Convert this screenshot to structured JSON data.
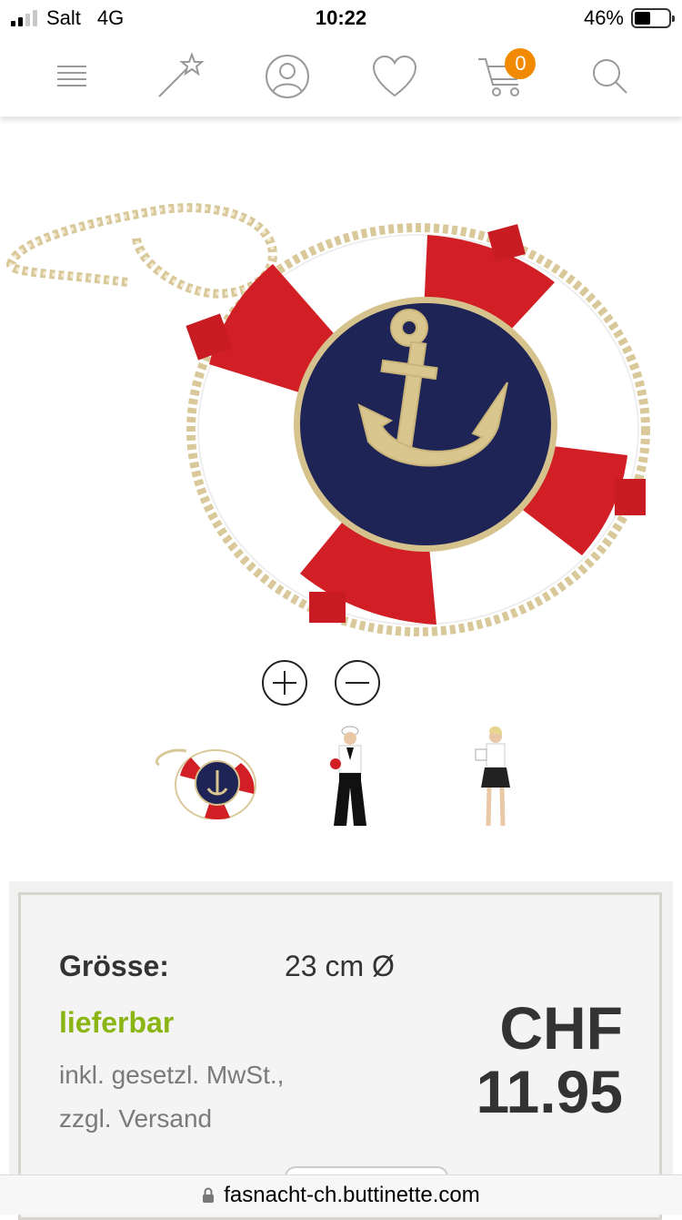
{
  "status_bar": {
    "carrier": "Salt",
    "network": "4G",
    "time": "10:22",
    "battery_percent": "46%",
    "battery_level": 0.46
  },
  "nav": {
    "icons": [
      "menu-icon",
      "magic-wand-icon",
      "account-icon",
      "wishlist-heart-icon",
      "cart-icon",
      "search-icon"
    ],
    "cart_count": "0",
    "accent_color": "#f28a00"
  },
  "gallery": {
    "zoom_in_icon": "plus-circle-icon",
    "zoom_out_icon": "minus-circle-icon",
    "thumbnails": [
      "lifebuoy-bag",
      "sailor-costume-pants",
      "sailor-costume-skirt"
    ]
  },
  "product": {
    "size_label": "Grösse:",
    "size_value": "23 cm Ø",
    "availability": "lieferbar",
    "availability_color": "#8ab513",
    "tax_note_line1": "inkl. gesetzl. MwSt.,",
    "tax_note_line2": "zzgl. Versand",
    "currency": "CHF",
    "price": "11.95"
  },
  "browser": {
    "url": "fasnacht-ch.buttinette.com"
  }
}
